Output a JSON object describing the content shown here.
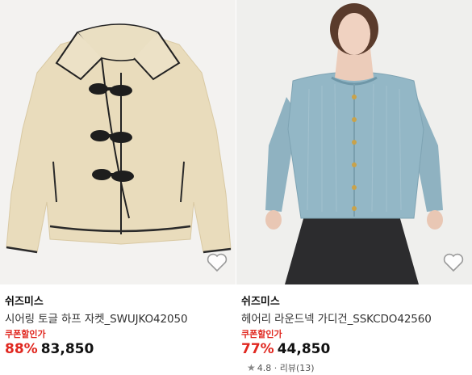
{
  "products": [
    {
      "brand": "쉬즈미스",
      "name": "시어링 토글 하프 자켓_SWUJKO42050",
      "coupon_label": "쿠폰할인가",
      "discount": "88%",
      "price": "83,850",
      "image_icon": "jacket-image"
    },
    {
      "brand": "쉬즈미스",
      "name": "헤어리 라운드넥 가디건_SSKCDO42560",
      "coupon_label": "쿠폰할인가",
      "discount": "77%",
      "price": "44,850",
      "rating": "4.8",
      "review_text": "리뷰(13)",
      "image_icon": "cardigan-model-image"
    }
  ],
  "wishlist_icon": "heart-icon"
}
